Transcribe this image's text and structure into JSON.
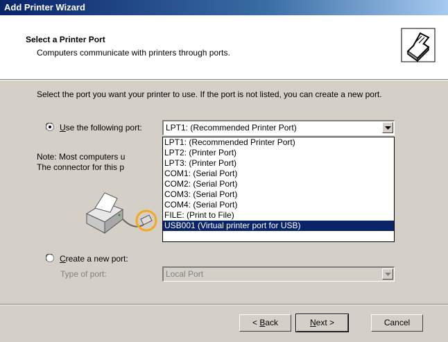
{
  "window": {
    "title": "Add Printer Wizard"
  },
  "header": {
    "title": "Select a Printer Port",
    "subtitle": "Computers communicate with printers through ports.",
    "icon": "printer-port-icon"
  },
  "body": {
    "instruction": "Select the port you want your printer to use.  If the port is not listed, you can create a new port."
  },
  "use_existing": {
    "label_accel": "U",
    "label_rest": "se the following port:",
    "selected": true,
    "value": "LPT1: (Recommended Printer Port)"
  },
  "note": {
    "line1": "Note: Most computers u",
    "line2": "The connector for this p"
  },
  "dropdown": {
    "items": [
      "LPT1: (Recommended Printer Port)",
      "LPT2: (Printer Port)",
      "LPT3: (Printer Port)",
      "COM1: (Serial Port)",
      "COM2: (Serial Port)",
      "COM3: (Serial Port)",
      "COM4: (Serial Port)",
      "FILE: (Print to File)",
      "USB001 (Virtual printer port for USB)"
    ],
    "highlighted_index": 8
  },
  "create_new": {
    "label_accel": "C",
    "label_rest": "reate a new port:",
    "selected": false,
    "type_label": "Type of port:",
    "type_value": "Local Port"
  },
  "buttons": {
    "back_prefix": "< ",
    "back_accel": "B",
    "back_rest": "ack",
    "next_accel": "N",
    "next_rest": "ext >",
    "cancel": "Cancel"
  },
  "colors": {
    "title_bar": "#0a246a",
    "selection": "#0a246a",
    "face": "#d4d0c8",
    "highlight_ring": "#f5a623"
  }
}
